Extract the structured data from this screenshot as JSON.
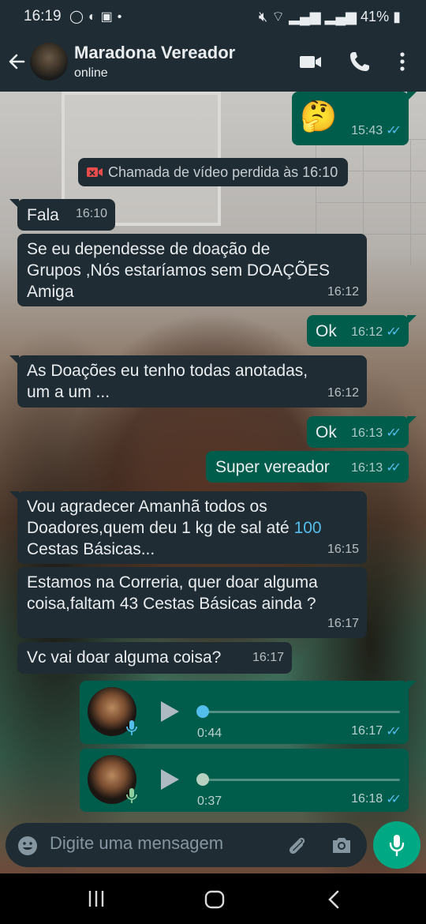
{
  "status_bar": {
    "time": "16:19",
    "left_icons": [
      "whatsapp-icon",
      "messenger-icon",
      "gallery-icon",
      "dot-icon"
    ],
    "battery": "41%",
    "right_icons": [
      "mute-icon",
      "wifi-icon",
      "signal-icon",
      "signal-icon",
      "battery-icon"
    ]
  },
  "header": {
    "name": "Maradona Vereador",
    "status": "online",
    "icons": [
      "back-arrow-icon",
      "video-call-icon",
      "voice-call-icon",
      "more-options-icon"
    ]
  },
  "system_message": {
    "icon": "missed-video-call-icon",
    "text": "Chamada de vídeo perdida às 16:10",
    "color": "#ea4c4c"
  },
  "messages": [
    {
      "direction": "out",
      "text": "🤔",
      "time": "15:43",
      "read": true
    },
    {
      "direction": "in",
      "text": "Fala",
      "time": "16:10"
    },
    {
      "direction": "in",
      "text": "Se eu dependesse de doação de\nGrupos ,Nós estaríamos sem DOAÇÕES\nAmiga",
      "time": "16:12"
    },
    {
      "direction": "out",
      "text": "Ok",
      "time": "16:12",
      "read": true
    },
    {
      "direction": "in",
      "text": "As Doações eu tenho todas anotadas,\num a um ...",
      "time": "16:12"
    },
    {
      "direction": "out",
      "text": "Ok",
      "time": "16:13",
      "read": true
    },
    {
      "direction": "out",
      "text": "Super vereador",
      "time": "16:13",
      "read": true
    },
    {
      "direction": "in",
      "text_before": "Vou agradecer Amanhã todos os\nDoadores,quem deu 1 kg de sal até ",
      "link": "100",
      "text_after": "\nCestas Básicas...",
      "time": "16:15"
    },
    {
      "direction": "in",
      "text": "Estamos na Correria, quer doar alguma\ncoisa,faltam 43 Cestas Básicas ainda ?",
      "time": "16:17"
    },
    {
      "direction": "in",
      "text": "Vc vai doar alguma coisa?",
      "time": "16:17"
    }
  ],
  "voice_messages": [
    {
      "duration": "0:44",
      "time": "16:17",
      "read": true,
      "progress": 0,
      "thumb_color": "#53bdeb",
      "mic_color": "#53bdeb"
    },
    {
      "duration": "0:37",
      "time": "16:18",
      "read": true,
      "progress": 0,
      "thumb_color": "#b8d0c0",
      "mic_color": "#8fd19e"
    }
  ],
  "input": {
    "placeholder": "Digite uma mensagem",
    "icons": [
      "emoji-icon",
      "attach-icon",
      "camera-icon",
      "microphone-icon"
    ]
  },
  "colors": {
    "header_bg": "#1f2c34",
    "incoming_bubble": "#1f2c34",
    "outgoing_bubble": "#005c4b",
    "read_ticks": "#53bdeb",
    "mic_button": "#00a884"
  },
  "nav_bar": {
    "icons": [
      "recent-apps-icon",
      "home-icon",
      "back-icon"
    ]
  }
}
